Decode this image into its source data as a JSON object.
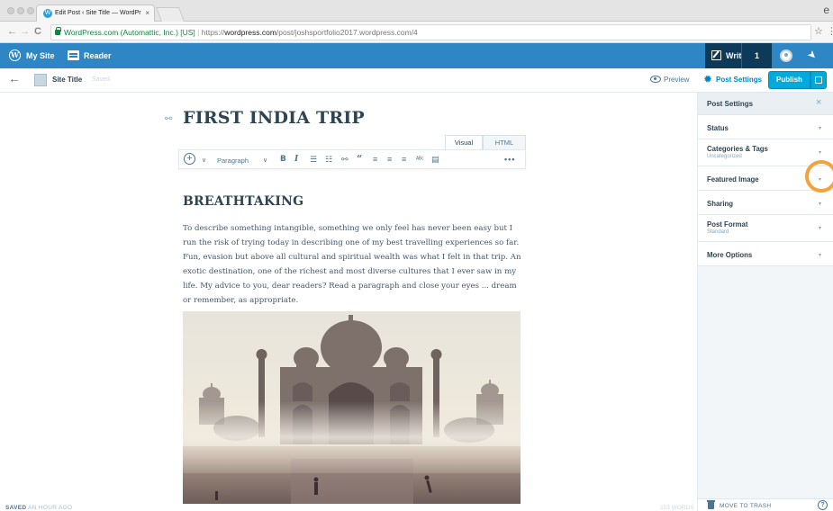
{
  "browser": {
    "tab_title": "Edit Post ‹ Site Title — WordPr",
    "tab_close": "×",
    "url_secure_label": "WordPress.com (Automattic, Inc.) [US]",
    "url_scheme": "https://",
    "url_host": "wordpress.com",
    "url_path": "/post/joshsportfolio2017.wordpress.com/4",
    "back_glyph": "←",
    "forward_glyph": "→",
    "reload_glyph": "C",
    "star_glyph": "☆",
    "menu_glyph": "⋮",
    "profile_glyph": "e"
  },
  "masterbar": {
    "my_site": "My Site",
    "reader": "Reader",
    "write": "Write",
    "notification_count": "1",
    "color": "#2f86c4"
  },
  "editor_header": {
    "site_title": "Site Title",
    "saved_status": "Saved",
    "preview": "Preview",
    "post_settings": "Post Settings",
    "publish": "Publish"
  },
  "editor": {
    "post_title": "FIRST INDIA TRIP",
    "mode_tabs": {
      "visual": "Visual",
      "html": "HTML",
      "active": "visual"
    },
    "toolbar": {
      "format": "Paragraph",
      "icons": [
        "add-icon",
        "bold-icon",
        "italic-icon",
        "bullet-list-icon",
        "numbered-list-icon",
        "link-icon",
        "blockquote-icon",
        "align-left-icon",
        "align-center-icon",
        "align-right-icon",
        "spellcheck-icon",
        "toolbar-toggle-icon",
        "more-icon"
      ]
    },
    "heading": "BREATHTAKING",
    "paragraph": "To describe something intangible, something we only feel has never been easy but I run the risk of trying today in describing one of my best travelling experiences so far. Fun, evasion but above all cultural and spiritual wealth was what I felt in that trip. An exotic destination, one of the richest and most diverse cultures that I ever saw in my life. My advice to you, dear readers? Read a paragraph and close your eyes ... dream or remember, as appropriate.",
    "image_subject": "taj-mahal-photo"
  },
  "footer": {
    "saved_label": "SAVED",
    "saved_time": "AN HOUR AGO",
    "word_count": "153 WORDS"
  },
  "sidebar": {
    "title": "Post Settings",
    "close_glyph": "×",
    "panels": [
      {
        "title": "Status",
        "subtitle": ""
      },
      {
        "title": "Categories & Tags",
        "subtitle": "Uncategorized"
      },
      {
        "title": "Featured Image",
        "subtitle": ""
      },
      {
        "title": "Sharing",
        "subtitle": ""
      },
      {
        "title": "Post Format",
        "subtitle": "Standard"
      },
      {
        "title": "More Options",
        "subtitle": ""
      }
    ],
    "chevron_glyph": "▾",
    "move_to_trash": "MOVE TO TRASH",
    "help_glyph": "?",
    "highlight_color": "#f4a23a"
  }
}
